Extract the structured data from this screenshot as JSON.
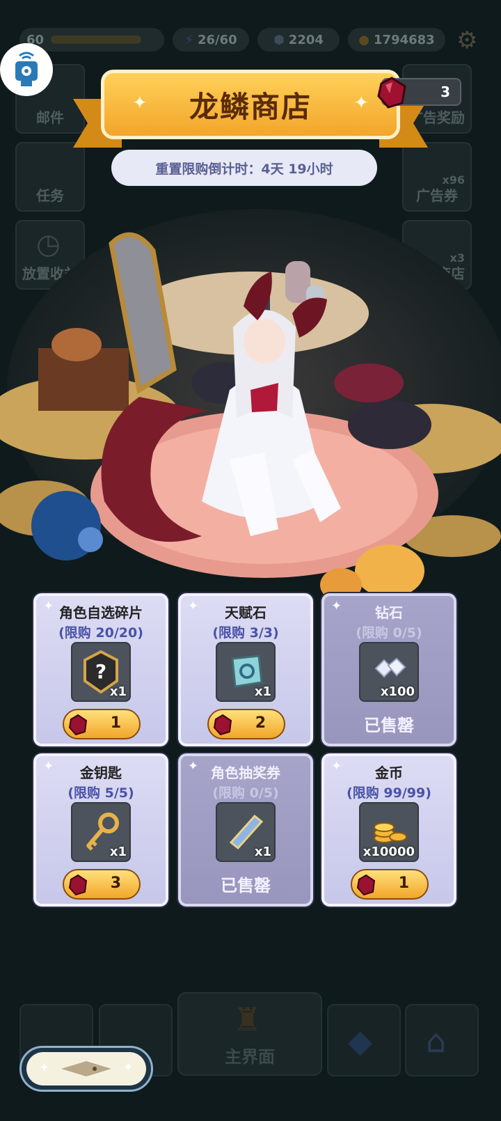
{
  "hud": {
    "level": "60",
    "energy": "26/60",
    "crystals": "2204",
    "gold": "1794683"
  },
  "side_left": [
    {
      "label": "邮件"
    },
    {
      "label": "任务"
    },
    {
      "label": "放置收益"
    }
  ],
  "side_right": [
    {
      "label": "广告奖励"
    },
    {
      "label": "广告券",
      "count": "x96"
    },
    {
      "label": "龙鳞商店",
      "count": "x3"
    }
  ],
  "shop": {
    "title": "龙鳞商店",
    "countdown": "重置限购倒计时：4天 19小时",
    "currency_count": "3",
    "sold_out_label": "已售罄",
    "items": [
      {
        "name": "角色自选碎片",
        "limit": "(限购 20/20)",
        "qty": "x1",
        "price": "1",
        "icon": "mystery-shard-icon",
        "sold_out": false
      },
      {
        "name": "天赋石",
        "limit": "(限购 3/3)",
        "qty": "x1",
        "price": "2",
        "icon": "talent-stone-icon",
        "sold_out": false
      },
      {
        "name": "钻石",
        "limit": "(限购 0/5)",
        "qty": "x100",
        "price": "",
        "icon": "diamond-icon",
        "sold_out": true
      },
      {
        "name": "金钥匙",
        "limit": "(限购 5/5)",
        "qty": "x1",
        "price": "3",
        "icon": "golden-key-icon",
        "sold_out": false
      },
      {
        "name": "角色抽奖券",
        "limit": "(限购 0/5)",
        "qty": "x1",
        "price": "",
        "icon": "lottery-ticket-icon",
        "sold_out": true
      },
      {
        "name": "金币",
        "limit": "(限购 99/99)",
        "qty": "x10000",
        "price": "1",
        "icon": "gold-coins-icon",
        "sold_out": false
      }
    ]
  },
  "bottom_nav": {
    "main_label": "主界面"
  }
}
